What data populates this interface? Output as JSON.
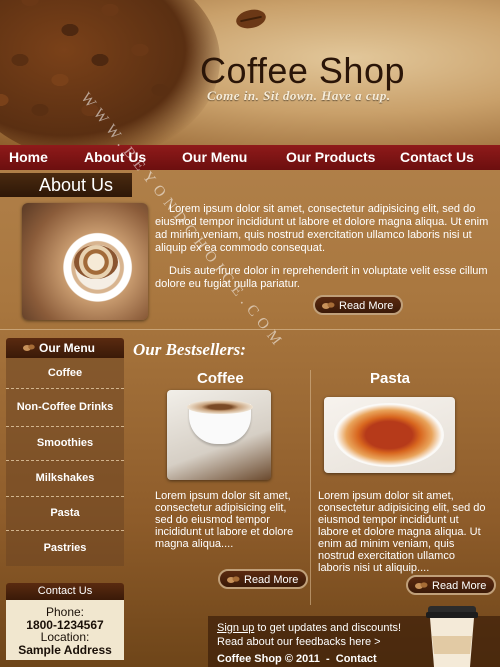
{
  "header": {
    "title": "Coffee Shop",
    "tagline": "Come in. Sit down. Have a cup."
  },
  "nav": {
    "items": [
      "Home",
      "About Us",
      "Our Menu",
      "Our Products",
      "Contact Us"
    ]
  },
  "about": {
    "heading": "About Us",
    "paragraph1": "Lorem ipsum dolor sit amet, consectetur adipisicing elit, sed do eiusmod tempor incididunt ut labore et dolore magna aliqua. Ut enim ad minim veniam, quis nostrud exercitation ullamco laboris nisi ut aliquip ex ea commodo consequat.",
    "paragraph2": "Duis aute irure dolor in reprehenderit in voluptate velit esse cillum dolore eu fugiat nulla pariatur.",
    "read_more": "Read More"
  },
  "menu": {
    "heading": "Our Menu",
    "items": [
      "Coffee",
      "Non-Coffee Drinks",
      "Smoothies",
      "Milkshakes",
      "Pasta",
      "Pastries"
    ]
  },
  "contact": {
    "heading": "Contact Us",
    "phone_label": "Phone:",
    "phone": "1800-1234567",
    "location_label": "Location:",
    "address": "Sample Address"
  },
  "bestsellers": {
    "heading": "Our Bestsellers:",
    "coffee": {
      "title": "Coffee",
      "text": "Lorem ipsum dolor sit amet, consectetur adipisicing elit, sed do eiusmod tempor incididunt ut labore et dolore magna aliqua....",
      "read_more": "Read More"
    },
    "pasta": {
      "title": "Pasta",
      "text": "Lorem ipsum dolor sit amet, consectetur adipisicing elit, sed do eiusmod tempor incididunt ut labore et dolore magna aliqua. Ut enim ad minim veniam, quis nostrud exercitation ullamco laboris nisi ut aliquip....",
      "read_more": "Read More"
    }
  },
  "footer": {
    "signup_link": "Sign up",
    "signup_rest": " to get updates and discounts!",
    "feedback": "Read about our feedbacks here >",
    "copyright": "Coffee Shop © 2011",
    "separator": "  -  ",
    "contact_link": "Contact"
  },
  "watermark": "WWW.BEYONDCHOICE.COM",
  "colors": {
    "nav_bar": "#7d1414",
    "dark_brown": "#3a1a08",
    "contact_bg": "#f1e7cf"
  }
}
